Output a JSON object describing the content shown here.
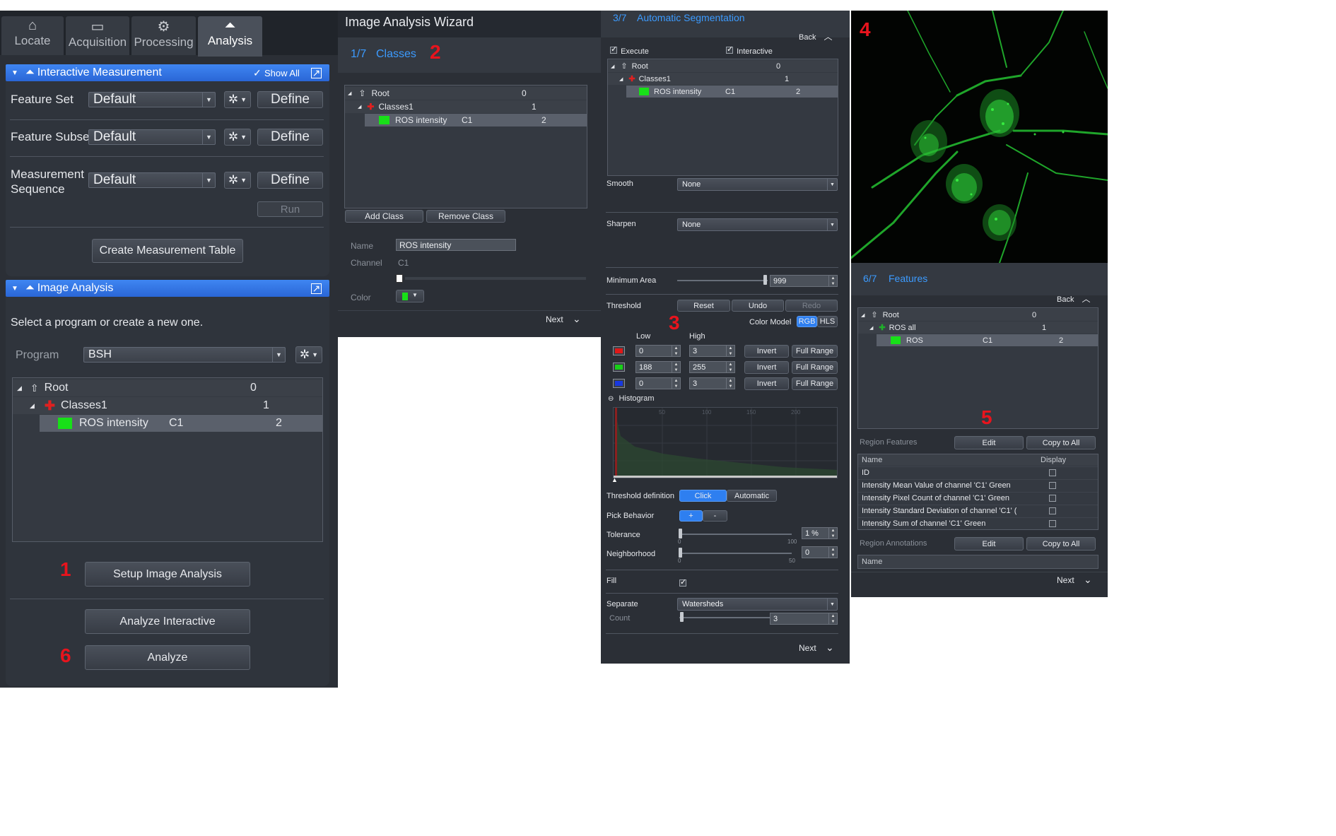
{
  "left_panel": {
    "tabs": [
      {
        "label": "Locate",
        "icon": "locate-icon"
      },
      {
        "label": "Acquisition",
        "icon": "acquisition-icon"
      },
      {
        "label": "Processing",
        "icon": "processing-gear-icon"
      },
      {
        "label": "Analysis",
        "icon": "analysis-icon",
        "active": true
      }
    ],
    "interactive_measurement": {
      "title": "Interactive Measurement",
      "show_all": "Show All",
      "rows": [
        {
          "label": "Feature Set",
          "value": "Default",
          "define": "Define"
        },
        {
          "label": "Feature Subset",
          "value": "Default",
          "define": "Define"
        },
        {
          "label_line1": "Measurement",
          "label_line2": "Sequence",
          "value": "Default",
          "define": "Define"
        }
      ],
      "run": "Run",
      "create_table": "Create Measurement Table"
    },
    "image_analysis": {
      "title": "Image Analysis",
      "prompt": "Select a program or create a new one.",
      "program_label": "Program",
      "program_value": "BSH",
      "tree": [
        {
          "name": "Root",
          "channel": "",
          "num": "0"
        },
        {
          "name": "Classes1",
          "channel": "",
          "num": "1"
        },
        {
          "name": "ROS intensity",
          "channel": "C1",
          "num": "2"
        }
      ],
      "setup": "Setup Image Analysis",
      "analyze_interactive": "Analyze Interactive",
      "analyze": "Analyze"
    }
  },
  "wizard": {
    "title": "Image Analysis Wizard",
    "step": "1/7",
    "step_name": "Classes",
    "tree": [
      {
        "name": "Root",
        "channel": "",
        "num": "0"
      },
      {
        "name": "Classes1",
        "channel": "",
        "num": "1"
      },
      {
        "name": "ROS intensity",
        "channel": "C1",
        "num": "2"
      }
    ],
    "add_class": "Add Class",
    "remove_class": "Remove Class",
    "name_label": "Name",
    "name_value": "ROS intensity",
    "channel_label": "Channel",
    "channel_value": "C1",
    "color_label": "Color",
    "next": "Next"
  },
  "segmentation": {
    "step": "3/7",
    "step_name": "Automatic Segmentation",
    "back": "Back",
    "execute": "Execute",
    "interactive": "Interactive",
    "tree": [
      {
        "name": "Root",
        "channel": "",
        "num": "0"
      },
      {
        "name": "Classes1",
        "channel": "",
        "num": "1"
      },
      {
        "name": "ROS intensity",
        "channel": "C1",
        "num": "2"
      }
    ],
    "smooth_label": "Smooth",
    "smooth_value": "None",
    "sharpen_label": "Sharpen",
    "sharpen_value": "None",
    "min_area_label": "Minimum Area",
    "min_area_value": "999",
    "threshold_label": "Threshold",
    "reset": "Reset",
    "undo": "Undo",
    "redo": "Redo",
    "color_model_label": "Color Model",
    "rgb": "RGB",
    "hls": "HLS",
    "low_label": "Low",
    "high_label": "High",
    "channels": [
      {
        "color": "#e01818",
        "low": "0",
        "high": "3"
      },
      {
        "color": "#18d018",
        "low": "188",
        "high": "255"
      },
      {
        "color": "#1838e0",
        "low": "0",
        "high": "3"
      }
    ],
    "invert": "Invert",
    "full_range": "Full Range",
    "histogram_label": "Histogram",
    "histogram_ticks": [
      "50",
      "100",
      "150",
      "200"
    ],
    "threshold_def_label": "Threshold definition",
    "click": "Click",
    "automatic": "Automatic",
    "pick_label": "Pick Behavior",
    "pick_plus": "+",
    "pick_minus": "-",
    "tolerance_label": "Tolerance",
    "tolerance_value": "1 %",
    "tolerance_min": "0",
    "tolerance_max": "100",
    "neighborhood_label": "Neighborhood",
    "neighborhood_value": "0",
    "neighborhood_min": "0",
    "neighborhood_max": "50",
    "fill_label": "Fill",
    "separate_label": "Separate",
    "separate_value": "Watersheds",
    "count_label": "Count",
    "count_value": "3",
    "next": "Next"
  },
  "features": {
    "step": "6/7",
    "step_name": "Features",
    "back": "Back",
    "tree": [
      {
        "name": "Root",
        "channel": "",
        "num": "0"
      },
      {
        "name": "ROS all",
        "channel": "",
        "num": "1"
      },
      {
        "name": "ROS",
        "channel": "C1",
        "num": "2"
      }
    ],
    "region_features_label": "Region Features",
    "edit": "Edit",
    "copy_to_all": "Copy to All",
    "col_name": "Name",
    "col_display": "Display",
    "feature_rows": [
      "ID",
      "Intensity Mean Value of channel 'C1' Green",
      "Intensity Pixel Count of channel 'C1' Green",
      "Intensity Standard Deviation of channel 'C1' (",
      "Intensity Sum of channel 'C1' Green"
    ],
    "region_annotations_label": "Region Annotations",
    "annot_col_name": "Name",
    "next": "Next"
  },
  "callouts": [
    "1",
    "2",
    "3",
    "4",
    "5",
    "6"
  ]
}
